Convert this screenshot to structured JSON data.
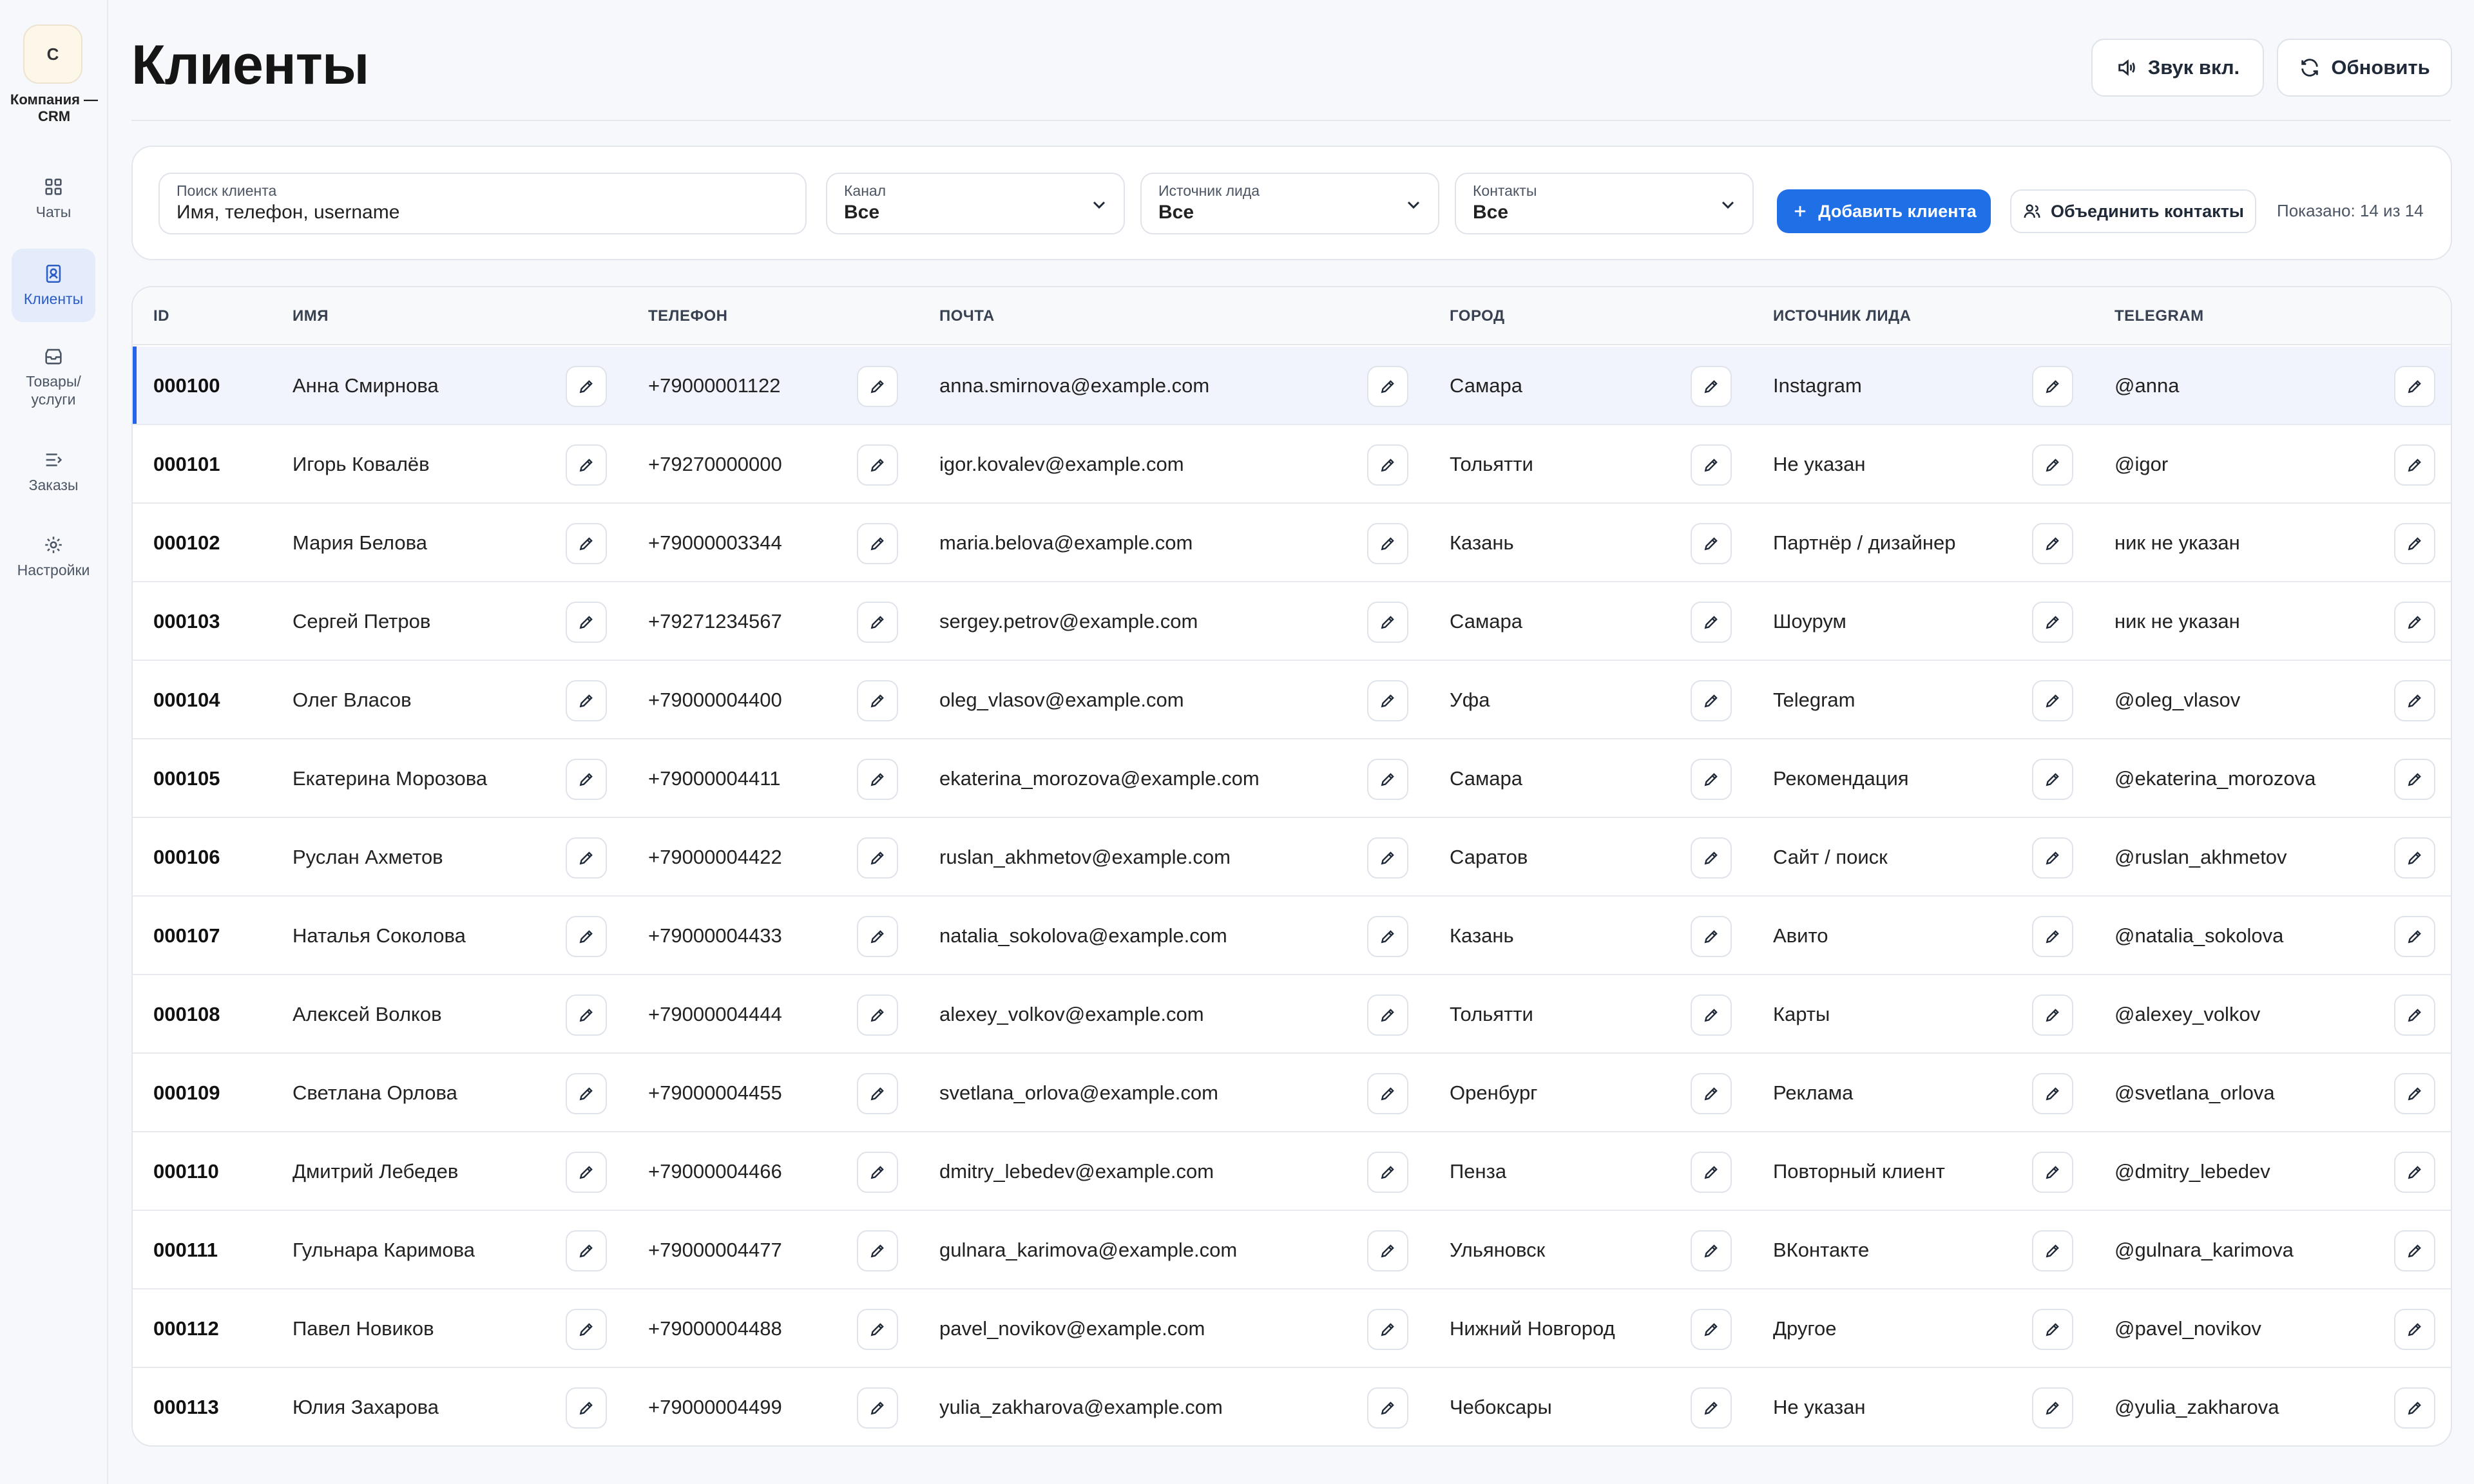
{
  "sidebar": {
    "logo_letter": "C",
    "company": "Компания — CRM",
    "items": [
      {
        "label": "Чаты",
        "icon": "grid-icon"
      },
      {
        "label": "Клиенты",
        "icon": "contact-icon",
        "active": true
      },
      {
        "label": "Товары/ услуги",
        "icon": "box-icon"
      },
      {
        "label": "Заказы",
        "icon": "orders-icon"
      },
      {
        "label": "Настройки",
        "icon": "gear-icon"
      }
    ]
  },
  "header": {
    "title": "Клиенты",
    "sound_label": "Звук вкл.",
    "refresh_label": "Обновить"
  },
  "filters": {
    "search": {
      "label": "Поиск клиента",
      "placeholder": "Имя, телефон, username"
    },
    "channel": {
      "label": "Канал",
      "value": "Все"
    },
    "lead_source": {
      "label": "Источник лида",
      "value": "Все"
    },
    "contacts": {
      "label": "Контакты",
      "value": "Все"
    },
    "add_label": "Добавить клиента",
    "merge_label": "Объединить контакты",
    "shown": "Показано: 14 из 14"
  },
  "table": {
    "columns": [
      "ID",
      "ИМЯ",
      "ТЕЛЕФОН",
      "ПОЧТА",
      "ГОРОД",
      "ИСТОЧНИК ЛИДА",
      "TELEGRAM"
    ],
    "rows": [
      {
        "id": "000100",
        "name": "Анна Смирнова",
        "phone": "+79000001122",
        "email": "anna.smirnova@example.com",
        "city": "Самара",
        "source": "Instagram",
        "telegram": "@anna"
      },
      {
        "id": "000101",
        "name": "Игорь Ковалёв",
        "phone": "+79270000000",
        "email": "igor.kovalev@example.com",
        "city": "Тольятти",
        "source": "Не указан",
        "telegram": "@igor"
      },
      {
        "id": "000102",
        "name": "Мария Белова",
        "phone": "+79000003344",
        "email": "maria.belova@example.com",
        "city": "Казань",
        "source": "Партнёр / дизайнер",
        "telegram": "ник не указан"
      },
      {
        "id": "000103",
        "name": "Сергей Петров",
        "phone": "+79271234567",
        "email": "sergey.petrov@example.com",
        "city": "Самара",
        "source": "Шоурум",
        "telegram": "ник не указан"
      },
      {
        "id": "000104",
        "name": "Олег Власов",
        "phone": "+79000004400",
        "email": "oleg_vlasov@example.com",
        "city": "Уфа",
        "source": "Telegram",
        "telegram": "@oleg_vlasov"
      },
      {
        "id": "000105",
        "name": "Екатерина Морозова",
        "phone": "+79000004411",
        "email": "ekaterina_morozova@example.com",
        "city": "Самара",
        "source": "Рекомендация",
        "telegram": "@ekaterina_morozova"
      },
      {
        "id": "000106",
        "name": "Руслан Ахметов",
        "phone": "+79000004422",
        "email": "ruslan_akhmetov@example.com",
        "city": "Саратов",
        "source": "Сайт / поиск",
        "telegram": "@ruslan_akhmetov"
      },
      {
        "id": "000107",
        "name": "Наталья Соколова",
        "phone": "+79000004433",
        "email": "natalia_sokolova@example.com",
        "city": "Казань",
        "source": "Авито",
        "telegram": "@natalia_sokolova"
      },
      {
        "id": "000108",
        "name": "Алексей Волков",
        "phone": "+79000004444",
        "email": "alexey_volkov@example.com",
        "city": "Тольятти",
        "source": "Карты",
        "telegram": "@alexey_volkov"
      },
      {
        "id": "000109",
        "name": "Светлана Орлова",
        "phone": "+79000004455",
        "email": "svetlana_orlova@example.com",
        "city": "Оренбург",
        "source": "Реклама",
        "telegram": "@svetlana_orlova"
      },
      {
        "id": "000110",
        "name": "Дмитрий Лебедев",
        "phone": "+79000004466",
        "email": "dmitry_lebedev@example.com",
        "city": "Пенза",
        "source": "Повторный клиент",
        "telegram": "@dmitry_lebedev"
      },
      {
        "id": "000111",
        "name": "Гульнара Каримова",
        "phone": "+79000004477",
        "email": "gulnara_karimova@example.com",
        "city": "Ульяновск",
        "source": "ВКонтакте",
        "telegram": "@gulnara_karimova"
      },
      {
        "id": "000112",
        "name": "Павел Новиков",
        "phone": "+79000004488",
        "email": "pavel_novikov@example.com",
        "city": "Нижний Новгород",
        "source": "Другое",
        "telegram": "@pavel_novikov"
      },
      {
        "id": "000113",
        "name": "Юлия Захарова",
        "phone": "+79000004499",
        "email": "yulia_zakharova@example.com",
        "city": "Чебоксары",
        "source": "Не указан",
        "telegram": "@yulia_zakharova"
      }
    ]
  },
  "colors": {
    "accent": "#1f6fe6",
    "active_nav_bg": "#e4ebfa",
    "selected_row": "#f1f4fd"
  }
}
